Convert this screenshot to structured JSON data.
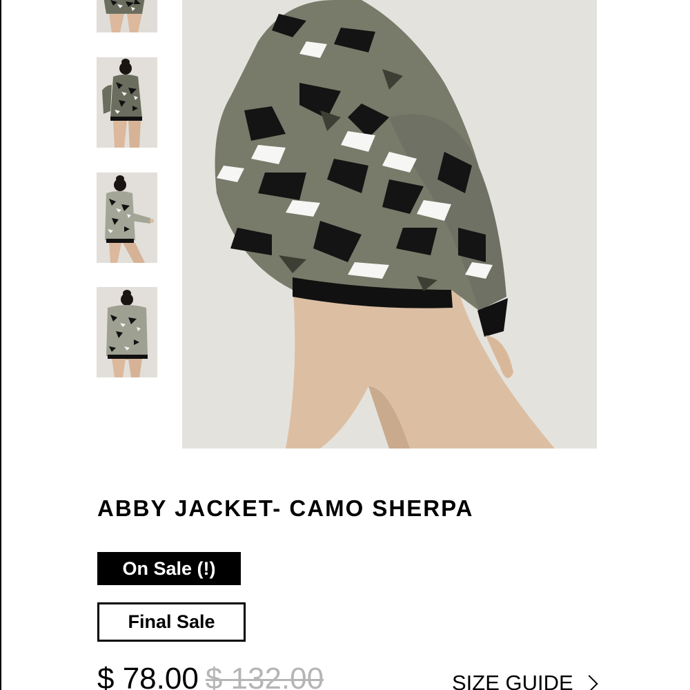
{
  "gallery": {
    "thumbnails": [
      {
        "name": "thumbnail-1",
        "view": "front-cropped"
      },
      {
        "name": "thumbnail-2",
        "view": "back"
      },
      {
        "name": "thumbnail-3",
        "view": "side-hood-up"
      },
      {
        "name": "thumbnail-4",
        "view": "back-hood-up"
      }
    ],
    "main_image": {
      "view": "side"
    }
  },
  "product": {
    "title": "ABBY JACKET- CAMO SHERPA",
    "badge_sale": "On Sale (!)",
    "badge_final": "Final Sale",
    "price_current": "$ 78.00",
    "price_original": "$ 132.00",
    "size_guide": "SIZE GUIDE",
    "size_guide_icon": "chevron-right-icon"
  },
  "colors": {
    "background": "#ffffff",
    "text": "#000000",
    "badge_sale_bg": "#000000",
    "strikethrough_price": "#b5b5b5",
    "photo_backdrop": "#e3e1dc"
  }
}
